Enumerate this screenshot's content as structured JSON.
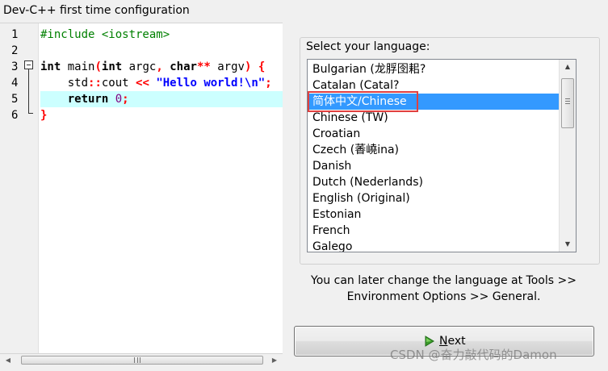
{
  "window": {
    "title": "Dev-C++ first time configuration"
  },
  "editor": {
    "line_numbers": [
      "1",
      "2",
      "3",
      "4",
      "5",
      "6"
    ],
    "code": {
      "l1": "#include <iostream>",
      "l3_kw1": "int",
      "l3_a": " main",
      "l3_p1": "(",
      "l3_kw2": "int",
      "l3_b": " argc",
      "l3_comma": ",",
      "l3_c": " ",
      "l3_kw3": "char",
      "l3_op": "**",
      "l3_d": " argv",
      "l3_p2": ")",
      "l3_e": " ",
      "l3_brace": "{",
      "l4_a": "    std",
      "l4_scope": "::",
      "l4_b": "cout ",
      "l4_op": "<<",
      "l4_c": " ",
      "l4_str": "\"Hello world!\\n\"",
      "l4_semi": ";",
      "l5_a": "    ",
      "l5_kw": "return",
      "l5_b": " ",
      "l5_num": "0",
      "l5_semi": ";",
      "l6": "}"
    },
    "active_line": 5
  },
  "language_panel": {
    "label": "Select your language:",
    "items": [
      "Bulgarian (龙脬囹耜?",
      "Catalan (Catal?",
      "简体中文/Chinese",
      "Chinese (TW)",
      "Croatian",
      "Czech (萫嶢ina)",
      "Danish",
      "Dutch (Nederlands)",
      "English (Original)",
      "Estonian",
      "French",
      "Galego"
    ],
    "selected_index": 2
  },
  "hint": {
    "line1": "You can later change the language at Tools >>",
    "line2": "Environment Options >> General."
  },
  "next_button": {
    "mnemonic": "N",
    "rest": "ext",
    "icon": "green-right-arrow-icon"
  },
  "watermark": "CSDN @奋力敲代码的Damon",
  "colors": {
    "selection": "#3399ff",
    "highlight_outline": "#e04040",
    "active_line": "#ccffff",
    "preprocessor": "#008000",
    "operator": "#ff0000",
    "string": "#0000ff",
    "number": "#800080"
  }
}
